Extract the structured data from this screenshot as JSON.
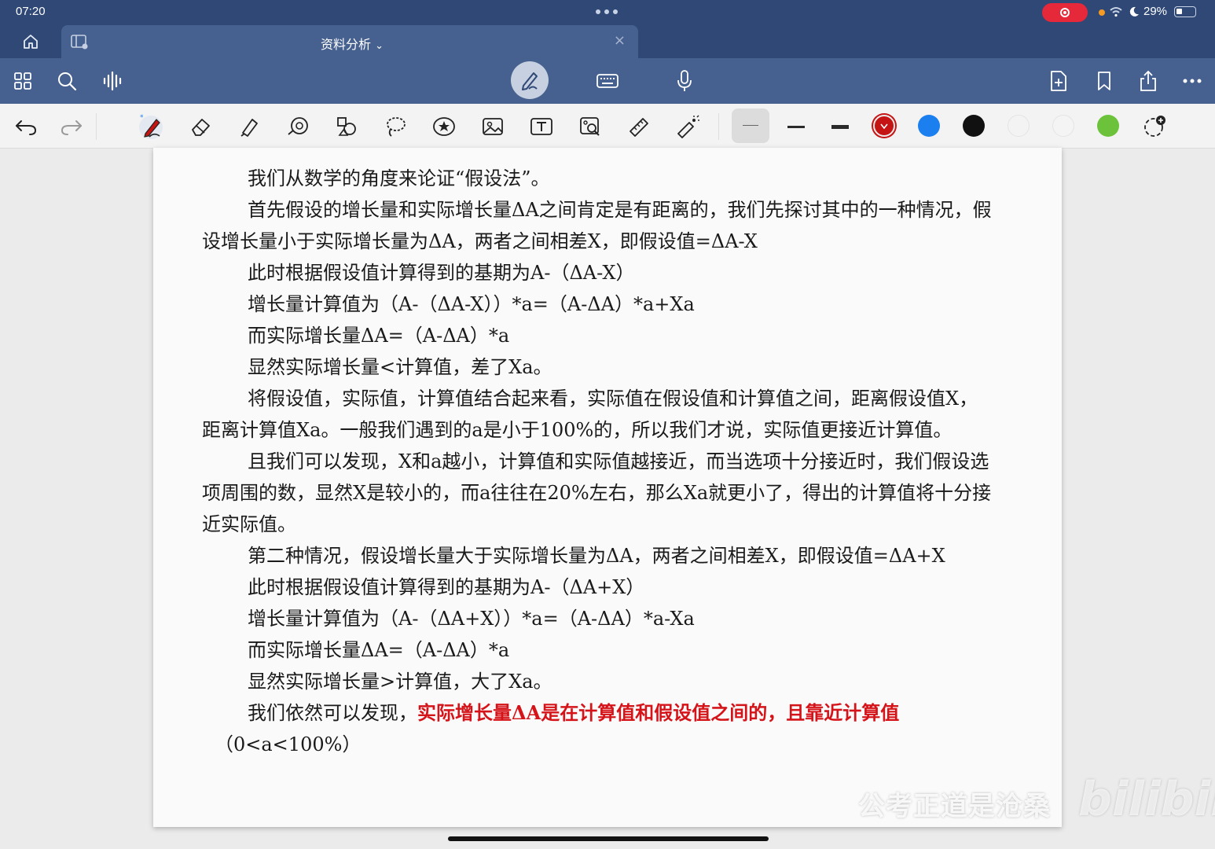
{
  "status": {
    "time": "07:20",
    "battery": "29%"
  },
  "tab": {
    "title": "资料分析",
    "close": "×"
  },
  "colors": {
    "red": "#c41413",
    "blue": "#1b7ff0",
    "black": "#111111",
    "white1": "#f3f3f3",
    "white2": "#f4f4f4",
    "green": "#6cc33b",
    "highlight": "#d5141a"
  },
  "icons": {
    "home": "home-icon",
    "sidebar": "sidebar-icon",
    "grid": "grid-icon",
    "search": "search-icon",
    "audio": "audio-waveform-icon",
    "pen": "pen-icon",
    "keyboard": "keyboard-icon",
    "mic": "microphone-icon",
    "add_page": "add-page-icon",
    "bookmark": "bookmark-icon",
    "share": "share-icon",
    "more": "more-icon"
  },
  "document": {
    "paragraphs": [
      {
        "indent": true,
        "text": "我们从数学的角度来论证“假设法”。"
      },
      {
        "indent": true,
        "text": "首先假设的增长量和实际增长量ΔA之间肯定是有距离的，我们先探讨其中的一种情况，假设增长量小于实际增长量为ΔA，两者之间相差X，即假设值=ΔA-X"
      },
      {
        "indent": true,
        "text": "此时根据假设值计算得到的基期为A-（ΔA-X）"
      },
      {
        "indent": true,
        "text": "增长量计算值为（A-（ΔA-X））*a=（A-ΔA）*a+Xa"
      },
      {
        "indent": true,
        "text": "而实际增长量ΔA=（A-ΔA）*a"
      },
      {
        "indent": true,
        "text": "显然实际增长量<计算值，差了Xa。"
      },
      {
        "indent": true,
        "text": "将假设值，实际值，计算值结合起来看，实际值在假设值和计算值之间，距离假设值X，距离计算值Xa。一般我们遇到的a是小于100%的，所以我们才说，实际值更接近计算值。"
      },
      {
        "indent": true,
        "text": "且我们可以发现，X和a越小，计算值和实际值越接近，而当选项十分接近时，我们假设选项周围的数，显然X是较小的，而a往往在20%左右，那么Xa就更小了，得出的计算值将十分接近实际值。"
      },
      {
        "indent": true,
        "text": "第二种情况，假设增长量大于实际增长量为ΔA，两者之间相差X，即假设值=ΔA+X"
      },
      {
        "indent": true,
        "text": "此时根据假设值计算得到的基期为A-（ΔA+X）"
      },
      {
        "indent": true,
        "text": "增长量计算值为（A-（ΔA+X））*a=（A-ΔA）*a-Xa"
      },
      {
        "indent": true,
        "text": "而实际增长量ΔA=（A-ΔA）*a"
      },
      {
        "indent": true,
        "text": "显然实际增长量>计算值，大了Xa。"
      }
    ],
    "last_prefix": "我们依然可以发现，",
    "last_highlight": "实际增长量ΔA是在计算值和假设值之间的，且靠近计算值",
    "last_suffix": "（0<a<100%）"
  },
  "watermark": {
    "channel": "公考正道是沧桑",
    "site": "bilibili"
  }
}
